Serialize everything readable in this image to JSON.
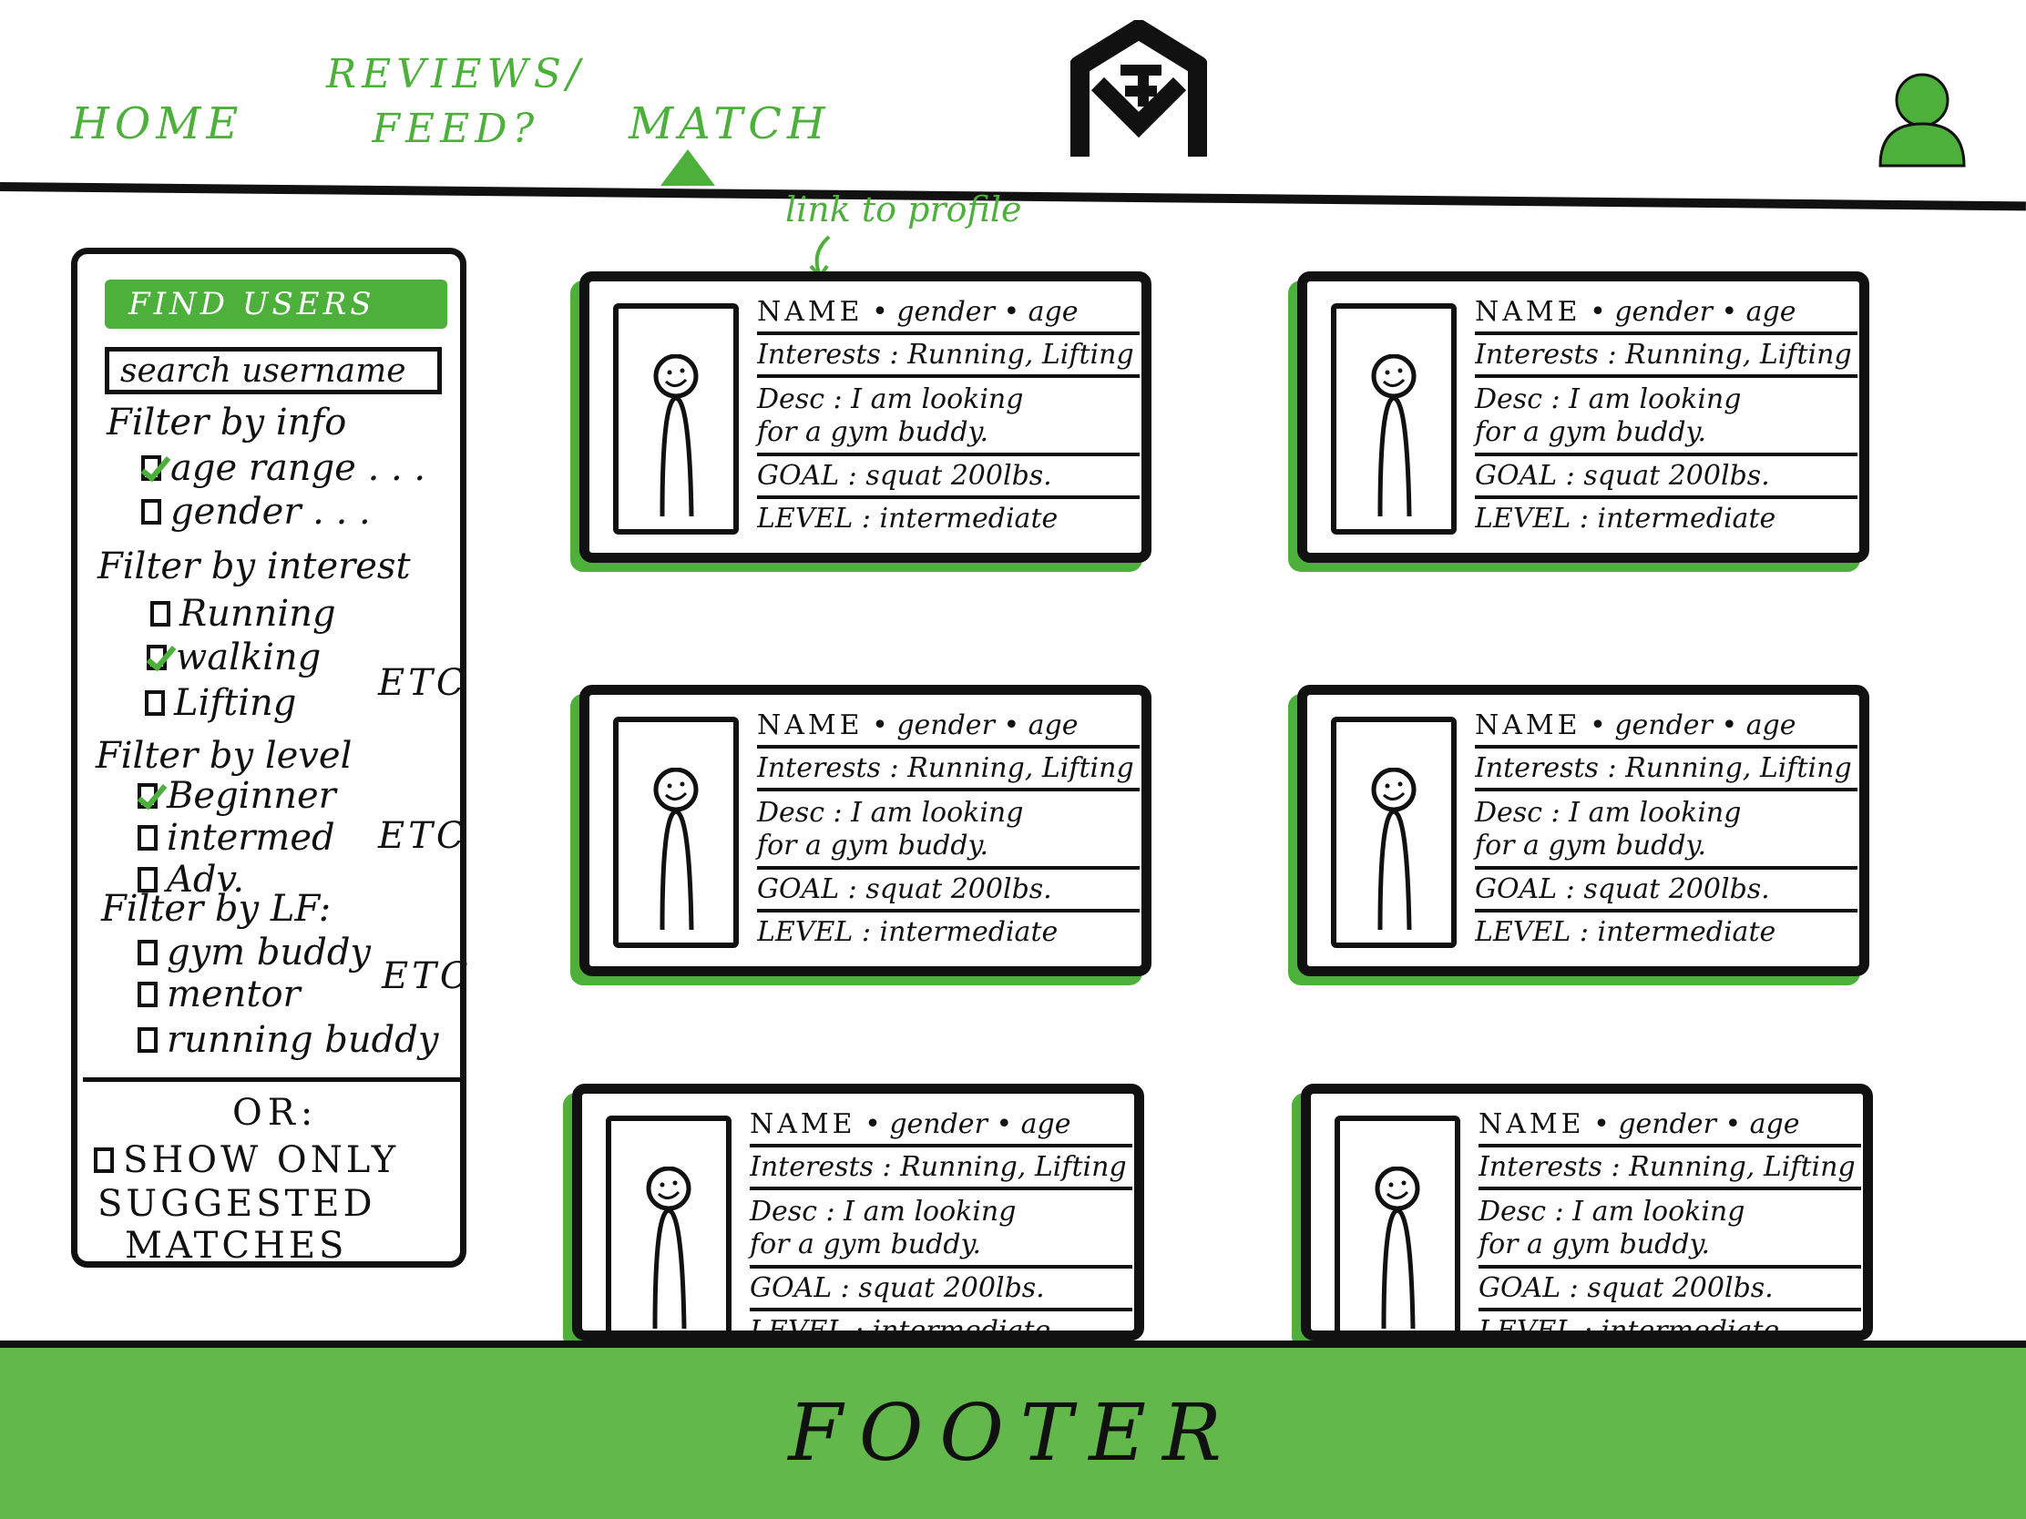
{
  "nav": {
    "home": "HOME",
    "reviews_line1": "REVIEWS/",
    "reviews_line2": "FEED?",
    "match": "MATCH"
  },
  "annotation": "link to profile",
  "sidebar": {
    "find_button": "FIND USERS",
    "search_placeholder": "search username",
    "info_heading": "Filter by info",
    "age_range": "age range . . .",
    "gender": "gender . . .",
    "interest_heading": "Filter by interest",
    "running": "Running",
    "walking": "walking",
    "lifting": "Lifting",
    "etc1": "ETC",
    "level_heading": "Filter by level",
    "beginner": "Beginner",
    "intermed": "intermed",
    "etc2": "ETC",
    "adv": "Adv.",
    "lf_heading": "Filter by LF:",
    "gym_buddy": "gym buddy",
    "etc3": "ETC",
    "mentor": "mentor",
    "running_buddy": "running buddy",
    "or_label": "OR:",
    "suggested_line1": "SHOW ONLY",
    "suggested_line2": "SUGGESTED",
    "suggested_line3": "MATCHES"
  },
  "cards": [
    {
      "name": "NAME",
      "meta": "• gender • age",
      "interests": "Interests : Running, Lifting",
      "desc1": "Desc : I am looking",
      "desc2": "for a gym buddy.",
      "goal": "GOAL : squat 200lbs.",
      "level": "LEVEL : intermediate"
    },
    {
      "name": "NAME",
      "meta": "• gender • age",
      "interests": "Interests : Running, Lifting",
      "desc1": "Desc : I am looking",
      "desc2": "for a gym buddy.",
      "goal": "GOAL : squat 200lbs.",
      "level": "LEVEL : intermediate"
    },
    {
      "name": "NAME",
      "meta": "• gender • age",
      "interests": "Interests : Running, Lifting",
      "desc1": "Desc : I am looking",
      "desc2": "for a gym buddy.",
      "goal": "GOAL : squat 200lbs.",
      "level": "LEVEL : intermediate"
    },
    {
      "name": "NAME",
      "meta": "• gender • age",
      "interests": "Interests : Running, Lifting",
      "desc1": "Desc : I am looking",
      "desc2": "for a gym buddy.",
      "goal": "GOAL : squat 200lbs.",
      "level": "LEVEL : intermediate"
    },
    {
      "name": "NAME",
      "meta": "• gender • age",
      "interests": "Interests : Running, Lifting",
      "desc1": "Desc : I am looking",
      "desc2": "for a gym buddy.",
      "goal": "GOAL : squat 200lbs.",
      "level": "LEVEL : intermediate"
    },
    {
      "name": "NAME",
      "meta": "• gender • age",
      "interests": "Interests : Running, Lifting",
      "desc1": "Desc : I am looking",
      "desc2": "for a gym buddy.",
      "goal": "GOAL : squat 200lbs.",
      "level": "LEVEL : intermediate"
    }
  ],
  "footer": "FOOTER",
  "colors": {
    "accent": "#4cb03a",
    "footer": "#63b84c",
    "ink": "#111111"
  },
  "icons": {
    "logo": "monogram-logo-icon",
    "avatar": "user-avatar-icon",
    "profile_figure": "stick-figure-icon"
  }
}
